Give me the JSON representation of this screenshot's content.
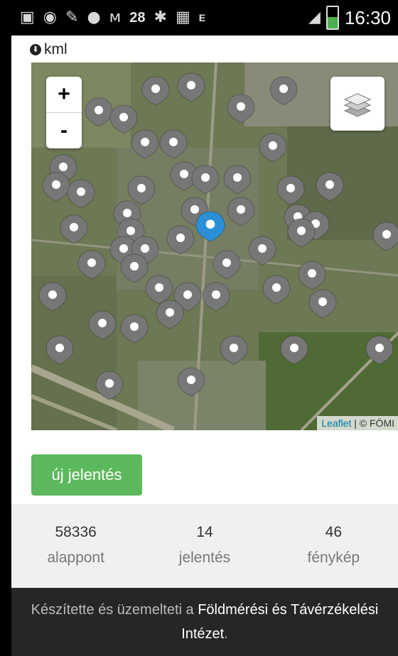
{
  "status_bar": {
    "notification_count": "28",
    "network_label": "E",
    "time": "16:30",
    "battery_level": 0.55
  },
  "kml": {
    "label": "kml"
  },
  "map": {
    "zoom_in": "+",
    "zoom_out": "-",
    "attribution_link": "Leaflet",
    "attribution_sep": " | ",
    "attribution_text": "© FÖMI"
  },
  "actions": {
    "new_report": "új jelentés"
  },
  "stats": [
    {
      "value": "58336",
      "label": "alappont"
    },
    {
      "value": "14",
      "label": "jelentés"
    },
    {
      "value": "46",
      "label": "fénykép"
    }
  ],
  "footer": {
    "text_before": "Készítette és üzemelteti a ",
    "link": "Földmérési és Távérzékelési Intézet",
    "text_after": "."
  },
  "colors": {
    "button": "#5cb85c",
    "marker_gray": "#777777",
    "marker_selected": "#2a8fd6",
    "footer_bg": "#262626"
  }
}
